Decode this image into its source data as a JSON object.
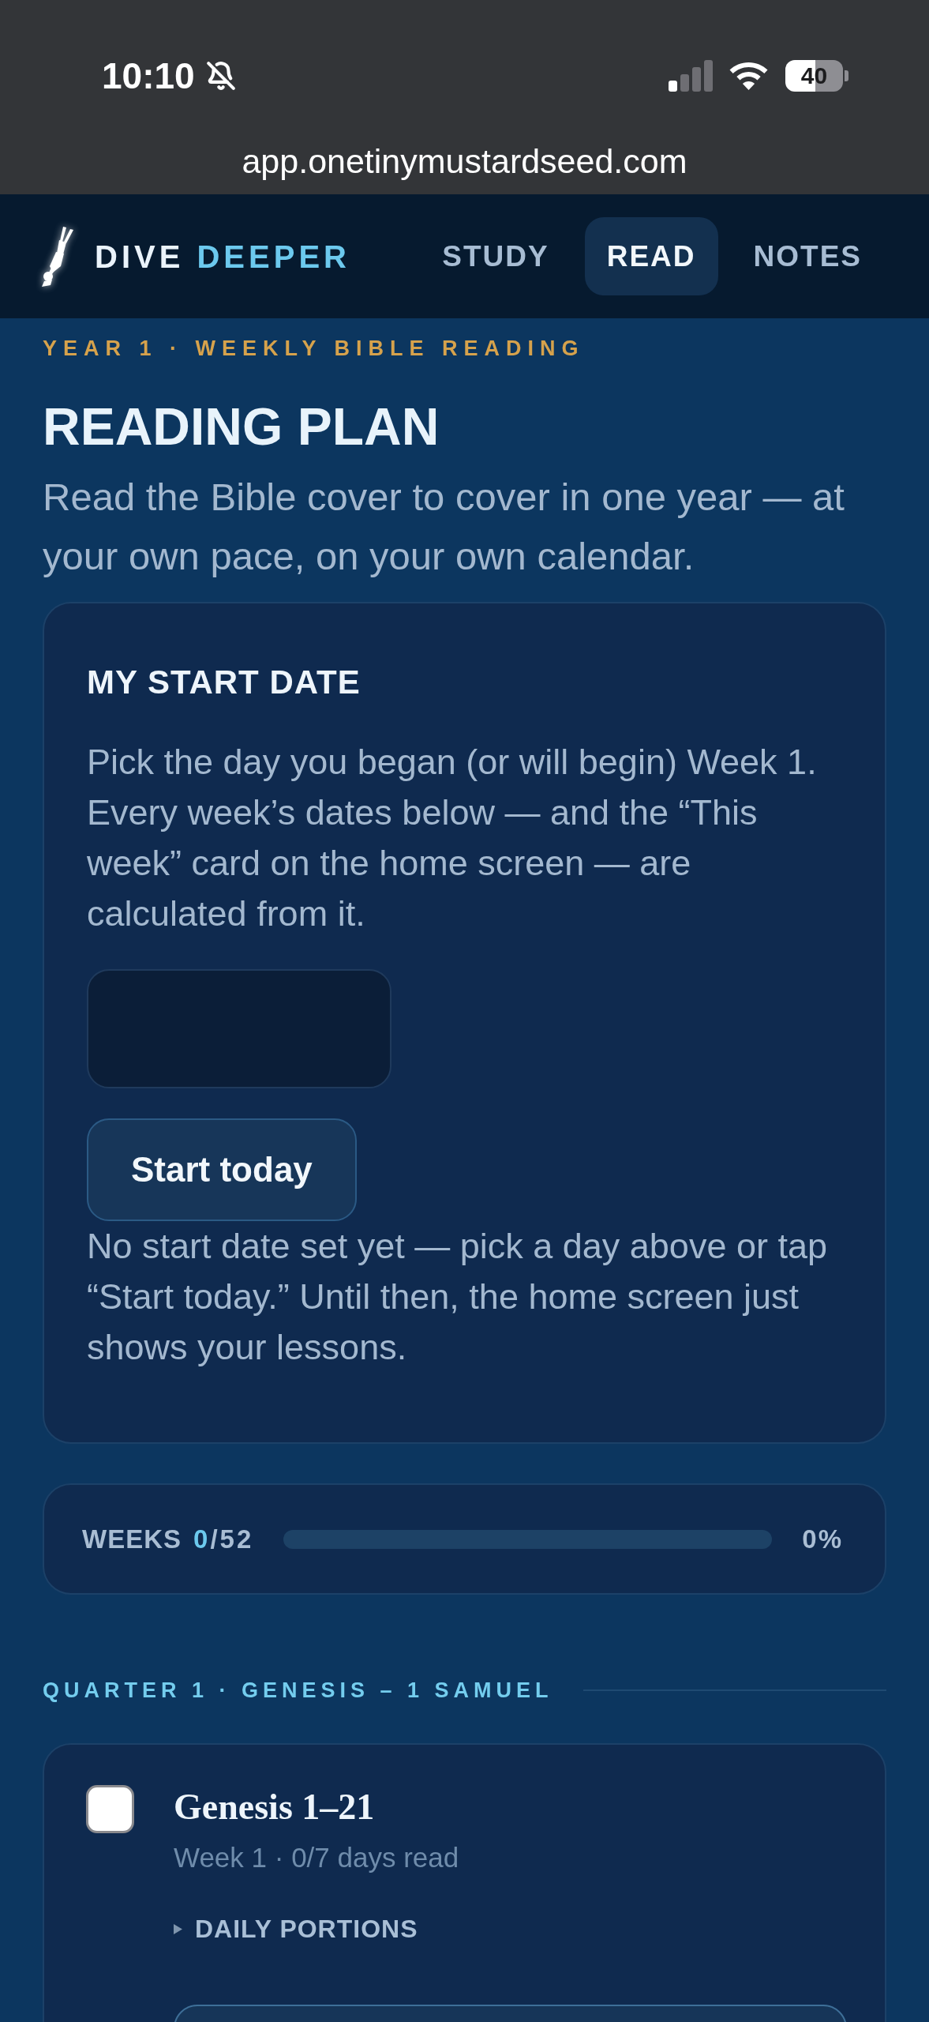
{
  "status_bar": {
    "time": "10:10",
    "silent": true,
    "battery": "40"
  },
  "browser": {
    "url": "app.onetinymustardseed.com"
  },
  "nav": {
    "brand": {
      "first": "DIVE",
      "second": "DEEPER"
    },
    "tabs": [
      {
        "label": "STUDY",
        "selected": false
      },
      {
        "label": "READ",
        "selected": true
      },
      {
        "label": "NOTES",
        "selected": false
      }
    ]
  },
  "header": {
    "eyebrow": "YEAR 1 · WEEKLY BIBLE READING",
    "title": "READING PLAN",
    "subtitle": "Read the Bible cover to cover in one year — at your own pace, on your own calendar."
  },
  "start_date": {
    "title": "MY START DATE",
    "description": "Pick the day you began (or will begin) Week 1. Every week’s dates below — and the “This week” card on the home screen — are calculated from it.",
    "button": "Start today",
    "note": "No start date set yet — pick a day above or tap “Start today.” Until then, the home screen just shows your lessons."
  },
  "progress": {
    "label": "WEEKS",
    "completed": "0",
    "total": "/52",
    "percent": "0%"
  },
  "quarters": [
    {
      "title": "QUARTER 1 · GENESIS – 1 SAMUEL",
      "weeks": [
        {
          "title": "Genesis 1–21",
          "checked": false,
          "meta": "Week 1 · 0/7 days read",
          "toggle": "DAILY PORTIONS",
          "expanded": false
        }
      ]
    }
  ]
}
